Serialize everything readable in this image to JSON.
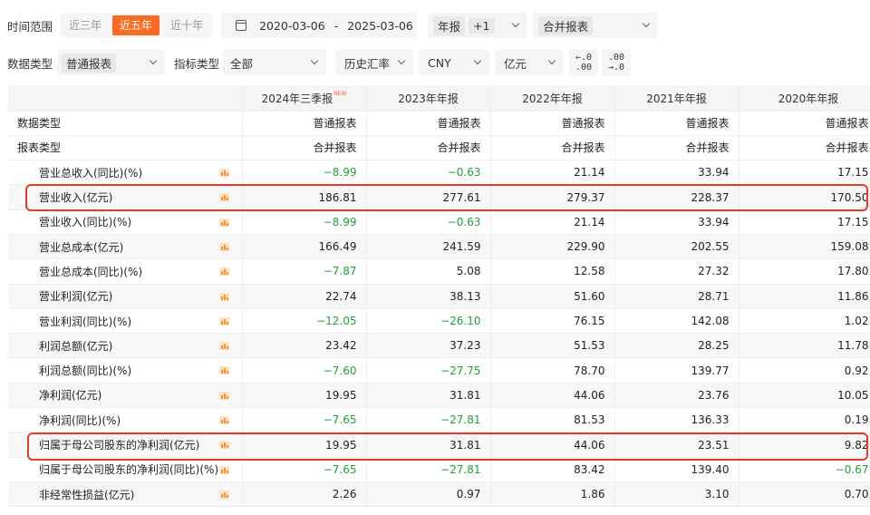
{
  "filters": {
    "time_range_label": "时间范围",
    "time_options": [
      "近三年",
      "近五年",
      "近十年"
    ],
    "time_selected": 1,
    "date_start": "2020-03-06",
    "date_sep": "-",
    "date_end": "2025-03-06",
    "period_tag": "年报",
    "period_extra": "+1",
    "report_scope": "合并报表",
    "data_type_label": "数据类型",
    "data_type_value": "普通报表",
    "indicator_label": "指标类型",
    "indicator_value": "全部",
    "rate_value": "历史汇率",
    "currency_value": "CNY",
    "unit_value": "亿元",
    "decimal_dec_top": "←.0",
    "decimal_dec_bottom": ".00",
    "decimal_inc_top": ".00",
    "decimal_inc_bottom": "→.0"
  },
  "table": {
    "columns": [
      "2024年三季报",
      "2023年年报",
      "2022年年报",
      "2021年年报",
      "2020年年报"
    ],
    "new_badge": "NEW",
    "meta_rows": [
      {
        "label": "数据类型",
        "values": [
          "普通报表",
          "普通报表",
          "普通报表",
          "普通报表",
          "普通报表"
        ]
      },
      {
        "label": "报表类型",
        "values": [
          "合并报表",
          "合并报表",
          "合并报表",
          "合并报表",
          "合并报表"
        ]
      }
    ],
    "rows": [
      {
        "label": "营业总收入(同比)(%)",
        "values": [
          "−8.99",
          "−0.63",
          "21.14",
          "33.94",
          "17.15"
        ],
        "neg": [
          true,
          true,
          false,
          false,
          false
        ]
      },
      {
        "label": "营业收入(亿元)",
        "values": [
          "186.81",
          "277.61",
          "279.37",
          "228.37",
          "170.50"
        ],
        "neg": [
          false,
          false,
          false,
          false,
          false
        ],
        "highlighted": true
      },
      {
        "label": "营业收入(同比)(%)",
        "values": [
          "−8.99",
          "−0.63",
          "21.14",
          "33.94",
          "17.15"
        ],
        "neg": [
          true,
          true,
          false,
          false,
          false
        ]
      },
      {
        "label": "营业总成本(亿元)",
        "values": [
          "166.49",
          "241.59",
          "229.90",
          "202.55",
          "159.08"
        ],
        "neg": [
          false,
          false,
          false,
          false,
          false
        ]
      },
      {
        "label": "营业总成本(同比)(%)",
        "values": [
          "−7.87",
          "5.08",
          "12.58",
          "27.32",
          "17.80"
        ],
        "neg": [
          true,
          false,
          false,
          false,
          false
        ]
      },
      {
        "label": "营业利润(亿元)",
        "values": [
          "22.74",
          "38.13",
          "51.60",
          "28.71",
          "11.86"
        ],
        "neg": [
          false,
          false,
          false,
          false,
          false
        ]
      },
      {
        "label": "营业利润(同比)(%)",
        "values": [
          "−12.05",
          "−26.10",
          "76.15",
          "142.08",
          "1.02"
        ],
        "neg": [
          true,
          true,
          false,
          false,
          false
        ]
      },
      {
        "label": "利润总额(亿元)",
        "values": [
          "23.42",
          "37.23",
          "51.53",
          "28.25",
          "11.78"
        ],
        "neg": [
          false,
          false,
          false,
          false,
          false
        ]
      },
      {
        "label": "利润总额(同比)(%)",
        "values": [
          "−7.60",
          "−27.75",
          "78.70",
          "139.77",
          "0.92"
        ],
        "neg": [
          true,
          true,
          false,
          false,
          false
        ]
      },
      {
        "label": "净利润(亿元)",
        "values": [
          "19.95",
          "31.81",
          "44.06",
          "23.76",
          "10.05"
        ],
        "neg": [
          false,
          false,
          false,
          false,
          false
        ]
      },
      {
        "label": "净利润(同比)(%)",
        "values": [
          "−7.65",
          "−27.81",
          "81.53",
          "136.33",
          "0.19"
        ],
        "neg": [
          true,
          true,
          false,
          false,
          false
        ]
      },
      {
        "label": "归属于母公司股东的净利润(亿元)",
        "values": [
          "19.95",
          "31.81",
          "44.06",
          "23.51",
          "9.82"
        ],
        "neg": [
          false,
          false,
          false,
          false,
          false
        ],
        "highlighted": true
      },
      {
        "label": "归属于母公司股东的净利润(同比)(%)",
        "values": [
          "−7.65",
          "−27.81",
          "83.42",
          "139.40",
          "−0.67"
        ],
        "neg": [
          true,
          true,
          false,
          false,
          true
        ]
      },
      {
        "label": "非经常性损益(亿元)",
        "values": [
          "2.26",
          "0.97",
          "1.86",
          "3.10",
          "0.70"
        ],
        "neg": [
          false,
          false,
          false,
          false,
          false
        ]
      }
    ]
  },
  "colors": {
    "accent": "#fb6a21",
    "negative": "#21a138",
    "highlight_border": "#e83a2a"
  },
  "icons": {
    "row_chart": "bar-chart-icon",
    "date": "calendar-icon"
  }
}
